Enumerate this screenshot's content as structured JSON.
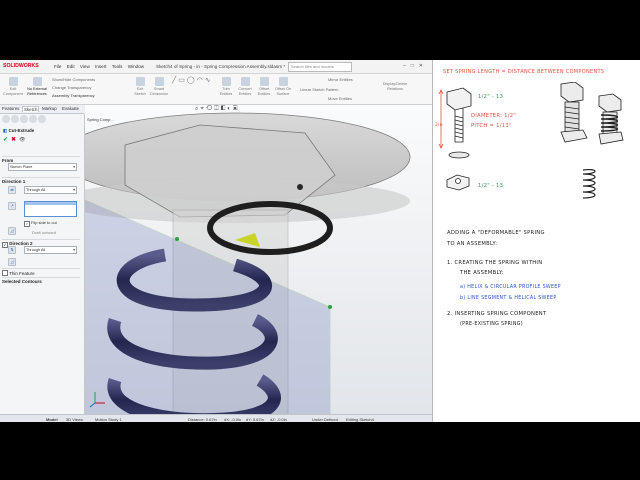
{
  "solidworks": {
    "brand": "SOLIDWORKS",
    "menus": [
      "File",
      "Edit",
      "View",
      "Insert",
      "Tools",
      "Window"
    ],
    "doc_title": "Sketch4 of Spring - in - Spring Compression Assembly.sldasm *",
    "search_placeholder": "Search files and models",
    "ribbon": {
      "edit_component": "Edit Component",
      "no_external_references": "No External References",
      "show_hidden_components": "Show/Hide Components",
      "change_transparency": "Change Transparency",
      "assembly_transparency": "Assembly Transparency",
      "exit_sketch": "Exit Sketch",
      "smart_dimension": "Smart Dimension",
      "trim_entities": "Trim Entities",
      "convert_entities": "Convert Entities",
      "offset_entities": "Offset Entities",
      "offset_on_surface": "Offset On Surface",
      "mirror_entities": "Mirror Entities",
      "linear_sketch_pattern": "Linear Sketch Pattern",
      "move_entities": "Move Entities",
      "display_delete_relations": "Display/Delete Relations"
    },
    "cm_tabs": [
      "Features",
      "Sketch",
      "Markup",
      "Evaluate"
    ],
    "active_cm_tab": "Sketch",
    "property_manager": {
      "title": "Cut-Extrude",
      "from_label": "From",
      "from_value": "Sketch Plane",
      "direction1_label": "Direction 1",
      "direction1_value": "Through All",
      "flip_side": "Flip side to cut",
      "draft_outward": "Draft outward",
      "direction2_label": "Direction 2",
      "direction2_value": "Through All",
      "thin_feature": "Thin Feature",
      "selected_contours": "Selected Contours"
    },
    "viewport": {
      "tree_label": "Spring Comp..."
    },
    "bottom_tabs": [
      "Model",
      "3D Views",
      "Motion Study 1"
    ],
    "status": {
      "distance": "Distance: 0.67in",
      "dx": "dX: -0.0in",
      "dy": "dY: 0.67in",
      "dz": "dZ: -0.0in",
      "defined": "Under Defined",
      "editing": "Editing Sketch4"
    }
  },
  "notes": {
    "heading": "SET SPRING LENGTH = DISTANCE BETWEEN COMPONENTS",
    "bolt_size": "1/2\" - 13",
    "dim_2in": "2in",
    "diameter": "DIAMETER: 1/2\"",
    "pitch": "PITCH = 1/13\"",
    "nut_size": "1/2\" - 13",
    "adding_line1": "ADDING A \"DEFORMABLE\" SPRING",
    "adding_line2": "TO AN ASSEMBLY:",
    "item1_line1": "1.  CREATING THE SPRING WITHIN",
    "item1_line2": "THE ASSEMBLY:",
    "item1a": "a)  HELIX & CIRCULAR PROFILE SWEEP",
    "item1b": "b)  LINE SEGMENT & HELICAL SWEEP",
    "item2_line1": "2.  INSERTING SPRING COMPONENT",
    "item2_line2": "(PRE-EXISTING SPRING)"
  }
}
